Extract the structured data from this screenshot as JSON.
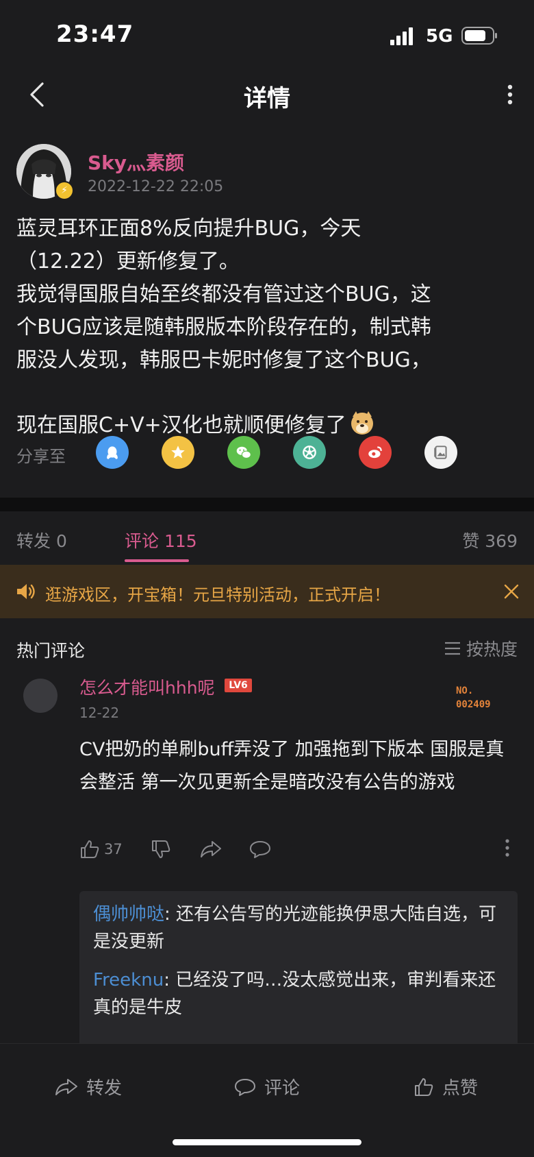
{
  "status": {
    "time": "23:47",
    "network": "5G"
  },
  "nav": {
    "title": "详情"
  },
  "post": {
    "author": "Sky灬素颜",
    "date": "2022-12-22 22:05",
    "body": "蓝灵耳环正面8%反向提升BUG，今天\n（12.22）更新修复了。\n我觉得国服自始至终都没有管过这个BUG，这\n个BUG应该是随韩服版本阶段存在的，制式韩\n服没人发现，韩服巴卡妮时修复了这个BUG，\n现在国服C+V+汉化也就顺便修复了"
  },
  "share": {
    "label": "分享至",
    "targets": [
      {
        "icon": "qq-icon",
        "color": "#4b9cf0"
      },
      {
        "icon": "qzone-icon",
        "color": "#f3c244"
      },
      {
        "icon": "wechat-icon",
        "color": "#5ec04c"
      },
      {
        "icon": "moments-icon",
        "color": "#4db295"
      },
      {
        "icon": "weibo-icon",
        "color": "#e3413b"
      },
      {
        "icon": "image-save-icon",
        "color": "#f2f2f2"
      }
    ]
  },
  "tabs": {
    "repost": "转发 0",
    "comments": "评论 115",
    "likes": "赞 369"
  },
  "notice": {
    "text": "逛游戏区，开宝箱！元旦特别活动，正式开启！"
  },
  "hot": {
    "title": "热门评论",
    "sort": "按热度"
  },
  "comment": {
    "user": "怎么才能叫hhh呢",
    "level": "LV6",
    "no_line1": "NO.",
    "no_line2": "002409",
    "date": "12-22",
    "text": "CV把奶的单刷buff弄没了 加强拖到下版本 国服是真会整活 第一次见更新全是暗改没有公告的游戏",
    "like_count": "37",
    "replies": [
      {
        "name": "偶帅帅哒",
        "text": ": 还有公告写的光迹能换伊思大陆自选，可是没更新"
      },
      {
        "name": "Freeknu",
        "text": ": 已经没了吗…没太感觉出来，审判看来还真的是牛皮"
      }
    ]
  },
  "bottom": {
    "repost": "转发",
    "comment": "评论",
    "like": "点赞"
  },
  "colors": {
    "accent": "#d95b8f",
    "link": "#4c8ed3",
    "notice": "#e7a646"
  }
}
